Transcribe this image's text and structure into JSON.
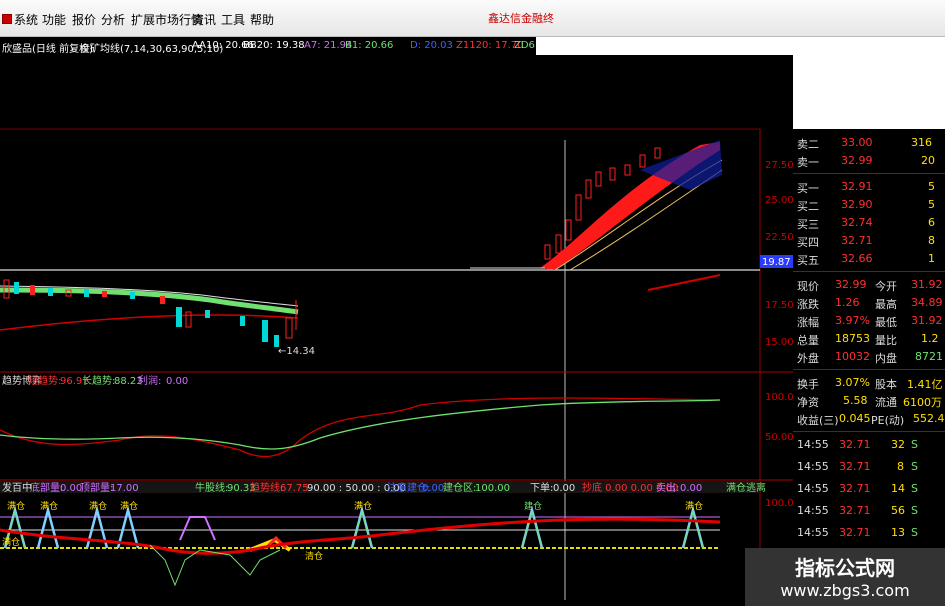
{
  "menu": {
    "items": [
      "系统",
      "功能",
      "报价",
      "分析",
      "扩展市场行情",
      "资讯",
      "工具",
      "帮助"
    ],
    "right_text": "鑫达信金融终"
  },
  "title_bar": {
    "name": "欣盛品(日线 前复权)",
    "indicator": "金矿均线(7,14,30,63,90,5,10)",
    "aa10": "AA10: 20.66",
    "bb20": "BB20: 19.38",
    "a7": "A7: 21.94",
    "b1": "B1: 20.66",
    "d": "D: 20.03",
    "z": "Z1120: 17.70",
    "zd": "ZD6"
  },
  "price_axis": [
    "27.50",
    "25.00",
    "22.50",
    "17.50",
    "15.00"
  ],
  "current_price_tag": "19.87",
  "low_annotation": "←14.34",
  "middle_panel": {
    "name": "趋势博弈",
    "short_label": "短趋势:",
    "short_value": "96.97",
    "long_label": "长趋势:",
    "long_value": "88.23",
    "profit_label": "利润:",
    "profit_value": "0.00",
    "axis": [
      "100.0",
      "50.00"
    ]
  },
  "bottom_panel": {
    "name": "发百中",
    "bottom_label": "底部量:",
    "bottom_value": "0.00",
    "top_label": "顶部量:",
    "top_value": "17.00",
    "bull_label": "牛股线:",
    "bull_value": "90.33",
    "trend_label": "趋势线:",
    "trend_value": "67.75",
    "triple": "90.00 : 50.00 : 0.00",
    "warn_label": "注意建仓:",
    "warn_value": "0.00",
    "pos_label": "建仓区:",
    "pos_value": "100.00",
    "down_label": "下单:",
    "down_value": "0.00",
    "tail_text": "抄底 0.00 0.00 0.00",
    "sell_label": "卖出:",
    "sell_value": "0.00",
    "sell_zone": "满仓逃离",
    "axis": "100.0",
    "tags": [
      "满仓",
      "满仓",
      "满仓",
      "满仓",
      "满仓",
      "满仓",
      "建仓",
      "满仓",
      "清仓"
    ]
  },
  "order_book": {
    "asks": [
      {
        "label": "卖二",
        "price": "33.00",
        "volume": "316"
      },
      {
        "label": "卖一",
        "price": "32.99",
        "volume": "20"
      }
    ],
    "bids": [
      {
        "label": "买一",
        "price": "32.91",
        "volume": "5"
      },
      {
        "label": "买二",
        "price": "32.90",
        "volume": "5"
      },
      {
        "label": "买三",
        "price": "32.74",
        "volume": "6"
      },
      {
        "label": "买四",
        "price": "32.71",
        "volume": "8"
      },
      {
        "label": "买五",
        "price": "32.66",
        "volume": "1"
      }
    ]
  },
  "stats": [
    {
      "l1": "现价",
      "v1": "32.99",
      "l2": "今开",
      "v2": "31.92"
    },
    {
      "l1": "涨跌",
      "v1": "1.26",
      "l2": "最高",
      "v2": "34.89"
    },
    {
      "l1": "涨幅",
      "v1": "3.97%",
      "l2": "最低",
      "v2": "31.92"
    },
    {
      "l1": "总量",
      "v1": "18753",
      "l2": "量比",
      "v2": "1.2"
    },
    {
      "l1": "外盘",
      "v1": "10032",
      "l2": "内盘",
      "v2": "8721"
    },
    {
      "l1": "换手",
      "v1": "3.07%",
      "l2": "股本",
      "v2": "1.41亿"
    },
    {
      "l1": "净资",
      "v1": "5.58",
      "l2": "流通",
      "v2": "6100万"
    },
    {
      "l1": "收益(三)",
      "v1": "0.045",
      "l2": "PE(动)",
      "v2": "552.4"
    }
  ],
  "ticks": [
    {
      "time": "14:55",
      "price": "32.71",
      "vol": "32",
      "side": "S"
    },
    {
      "time": "14:55",
      "price": "32.71",
      "vol": "8",
      "side": "S"
    },
    {
      "time": "14:55",
      "price": "32.71",
      "vol": "14",
      "side": "S"
    },
    {
      "time": "14:55",
      "price": "32.71",
      "vol": "56",
      "side": "S"
    },
    {
      "time": "14:55",
      "price": "32.71",
      "vol": "13",
      "side": "S"
    }
  ],
  "watermark": {
    "title": "指标公式网",
    "url": "www.zbgs3.com"
  },
  "colors": {
    "up": "#ff2020",
    "down": "#00d7d7",
    "price_text": "#ff3030",
    "label_text": "#c8c8c8",
    "axis": "#cc0000"
  }
}
